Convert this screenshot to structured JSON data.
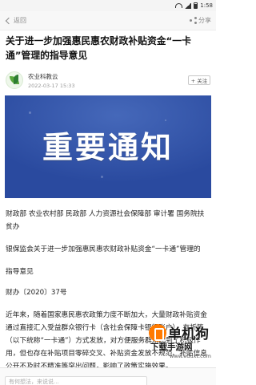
{
  "statusbar": {
    "time": "1:58"
  },
  "navbar": {
    "back_label": "返回",
    "share_label": "分享"
  },
  "article": {
    "title": "关于进一步加强惠民惠农财政补贴资金“一卡通”管理的指导意见",
    "author": "农业科教云",
    "date": "2022-03-17 15:33",
    "follow_label": "+ 关注",
    "banner_text": "重要通知",
    "paragraphs": [
      "财政部 农业农村部 民政部 人力资源社会保障部 审计署 国务院扶贫办",
      "银保监会关于进一步加强惠民惠农财政补贴资金“一卡通”管理的",
      "指导意见",
      "财办〔2020〕37号",
      "近年来，随着国家惠民惠农政策力度不断加大，大量财政补贴资金通过直接汇入受益群众银行卡（含社会保障卡银行账户）、存折等（以下统称“一卡通”）方式发放，对方便服务群众起到了积极作用，但也存在补贴项目零碎交叉、补贴资金发放不规范、补贴信息公开不及时不精准等突出问题，影响了政策实施效果。"
    ]
  },
  "watermark": {
    "title": "单机狗",
    "subtitle": "下载手游网",
    "url": "www.eduxt.com"
  },
  "comment": {
    "placeholder": "有何想法，来说说..."
  }
}
